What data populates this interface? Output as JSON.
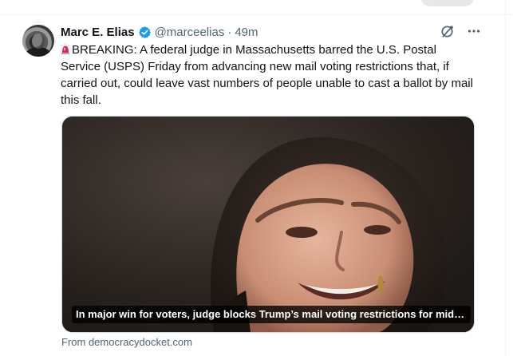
{
  "tweet": {
    "author_name": "Marc E. Elias",
    "handle": "@marceelias",
    "separator": "·",
    "time": "49m",
    "text": "BREAKING: A federal judge in Massachusetts barred the U.S. Postal Service (USPS) Friday from advancing new mail voting restrictions that, if carried out, could leave vast numbers of people unable to cast a ballot by mail this fall.",
    "more_icon": "ellipsis-icon",
    "grok_icon": "slashed-circle-icon",
    "verified_icon": "verified-badge-icon",
    "siren_icon": "siren-emoji-icon"
  },
  "link_card": {
    "title": "In major win for voters, judge blocks Trump’s mail voting restrictions for midter...",
    "source": "From democracydocket.com"
  },
  "colors": {
    "verified": "#1d9bf0",
    "secondary_text": "#536471",
    "border": "#cfd9de"
  }
}
